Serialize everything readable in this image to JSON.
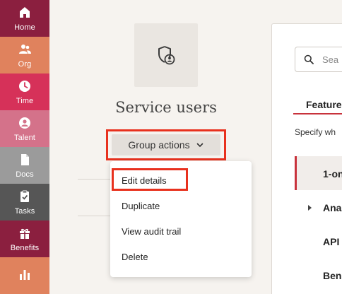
{
  "sidebar": {
    "items": [
      {
        "label": "Home",
        "icon": "home-icon",
        "color": "#8b1f3f"
      },
      {
        "label": "Org",
        "icon": "people-icon",
        "color": "#e0825d"
      },
      {
        "label": "Time",
        "icon": "clock-icon",
        "color": "#d63159"
      },
      {
        "label": "Talent",
        "icon": "user-circle-icon",
        "color": "#d4728a"
      },
      {
        "label": "Docs",
        "icon": "document-icon",
        "color": "#9b9b9b"
      },
      {
        "label": "Tasks",
        "icon": "clipboard-check-icon",
        "color": "#565656"
      },
      {
        "label": "Benefits",
        "icon": "gift-icon",
        "color": "#8b1f3f"
      },
      {
        "label": "",
        "icon": "bar-chart-icon",
        "color": "#e0825d"
      }
    ]
  },
  "header": {
    "title": "Service users",
    "group_actions_label": "Group actions"
  },
  "menu": {
    "items": [
      "Edit details",
      "Duplicate",
      "View audit trail",
      "Delete"
    ]
  },
  "panel": {
    "search_placeholder": "Sea",
    "tab_label": "Feature",
    "specify_text": "Specify wh",
    "rows": [
      "1-on",
      "Ana",
      "API",
      "Ben"
    ]
  },
  "colors": {
    "highlight": "#e8311e",
    "accent": "#c8323c",
    "background": "#f6f3ef"
  }
}
